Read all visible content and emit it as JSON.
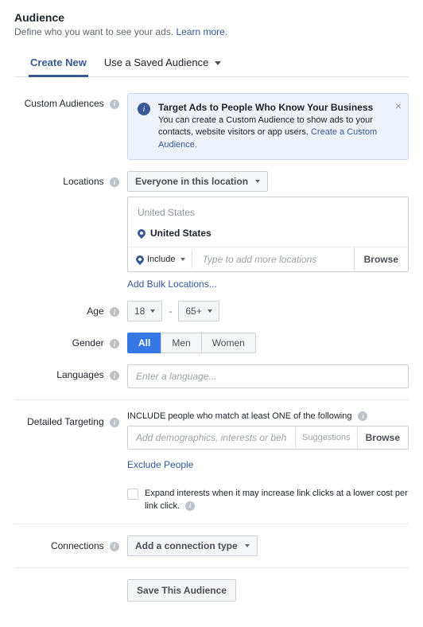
{
  "header": {
    "title": "Audience",
    "subtitle": "Define who you want to see your ads.",
    "learn_more": "Learn more."
  },
  "tabs": {
    "create": "Create New",
    "saved": "Use a Saved Audience"
  },
  "labels": {
    "custom_audiences": "Custom Audiences",
    "locations": "Locations",
    "age": "Age",
    "gender": "Gender",
    "languages": "Languages",
    "detailed_targeting": "Detailed Targeting",
    "connections": "Connections"
  },
  "callout": {
    "title": "Target Ads to People Who Know Your Business",
    "body": "You can create a Custom Audience to show ads to your contacts, website visitors or app users.",
    "link": "Create a Custom Audience."
  },
  "locations": {
    "scope": "Everyone in this location",
    "group_label": "United States",
    "item": "United States",
    "include": "Include",
    "placeholder": "Type to add more locations",
    "browse": "Browse",
    "bulk": "Add Bulk Locations..."
  },
  "age": {
    "min": "18",
    "max": "65+"
  },
  "gender": {
    "all": "All",
    "men": "Men",
    "women": "Women"
  },
  "languages": {
    "placeholder": "Enter a language..."
  },
  "detailed": {
    "include_heading": "INCLUDE people who match at least ONE of the following",
    "placeholder": "Add demographics, interests or behaviors",
    "suggestions": "Suggestions",
    "browse": "Browse",
    "exclude": "Exclude People",
    "expand": "Expand interests when it may increase link clicks at a lower cost per link click."
  },
  "connections": {
    "add": "Add a connection type"
  },
  "save": "Save This Audience"
}
